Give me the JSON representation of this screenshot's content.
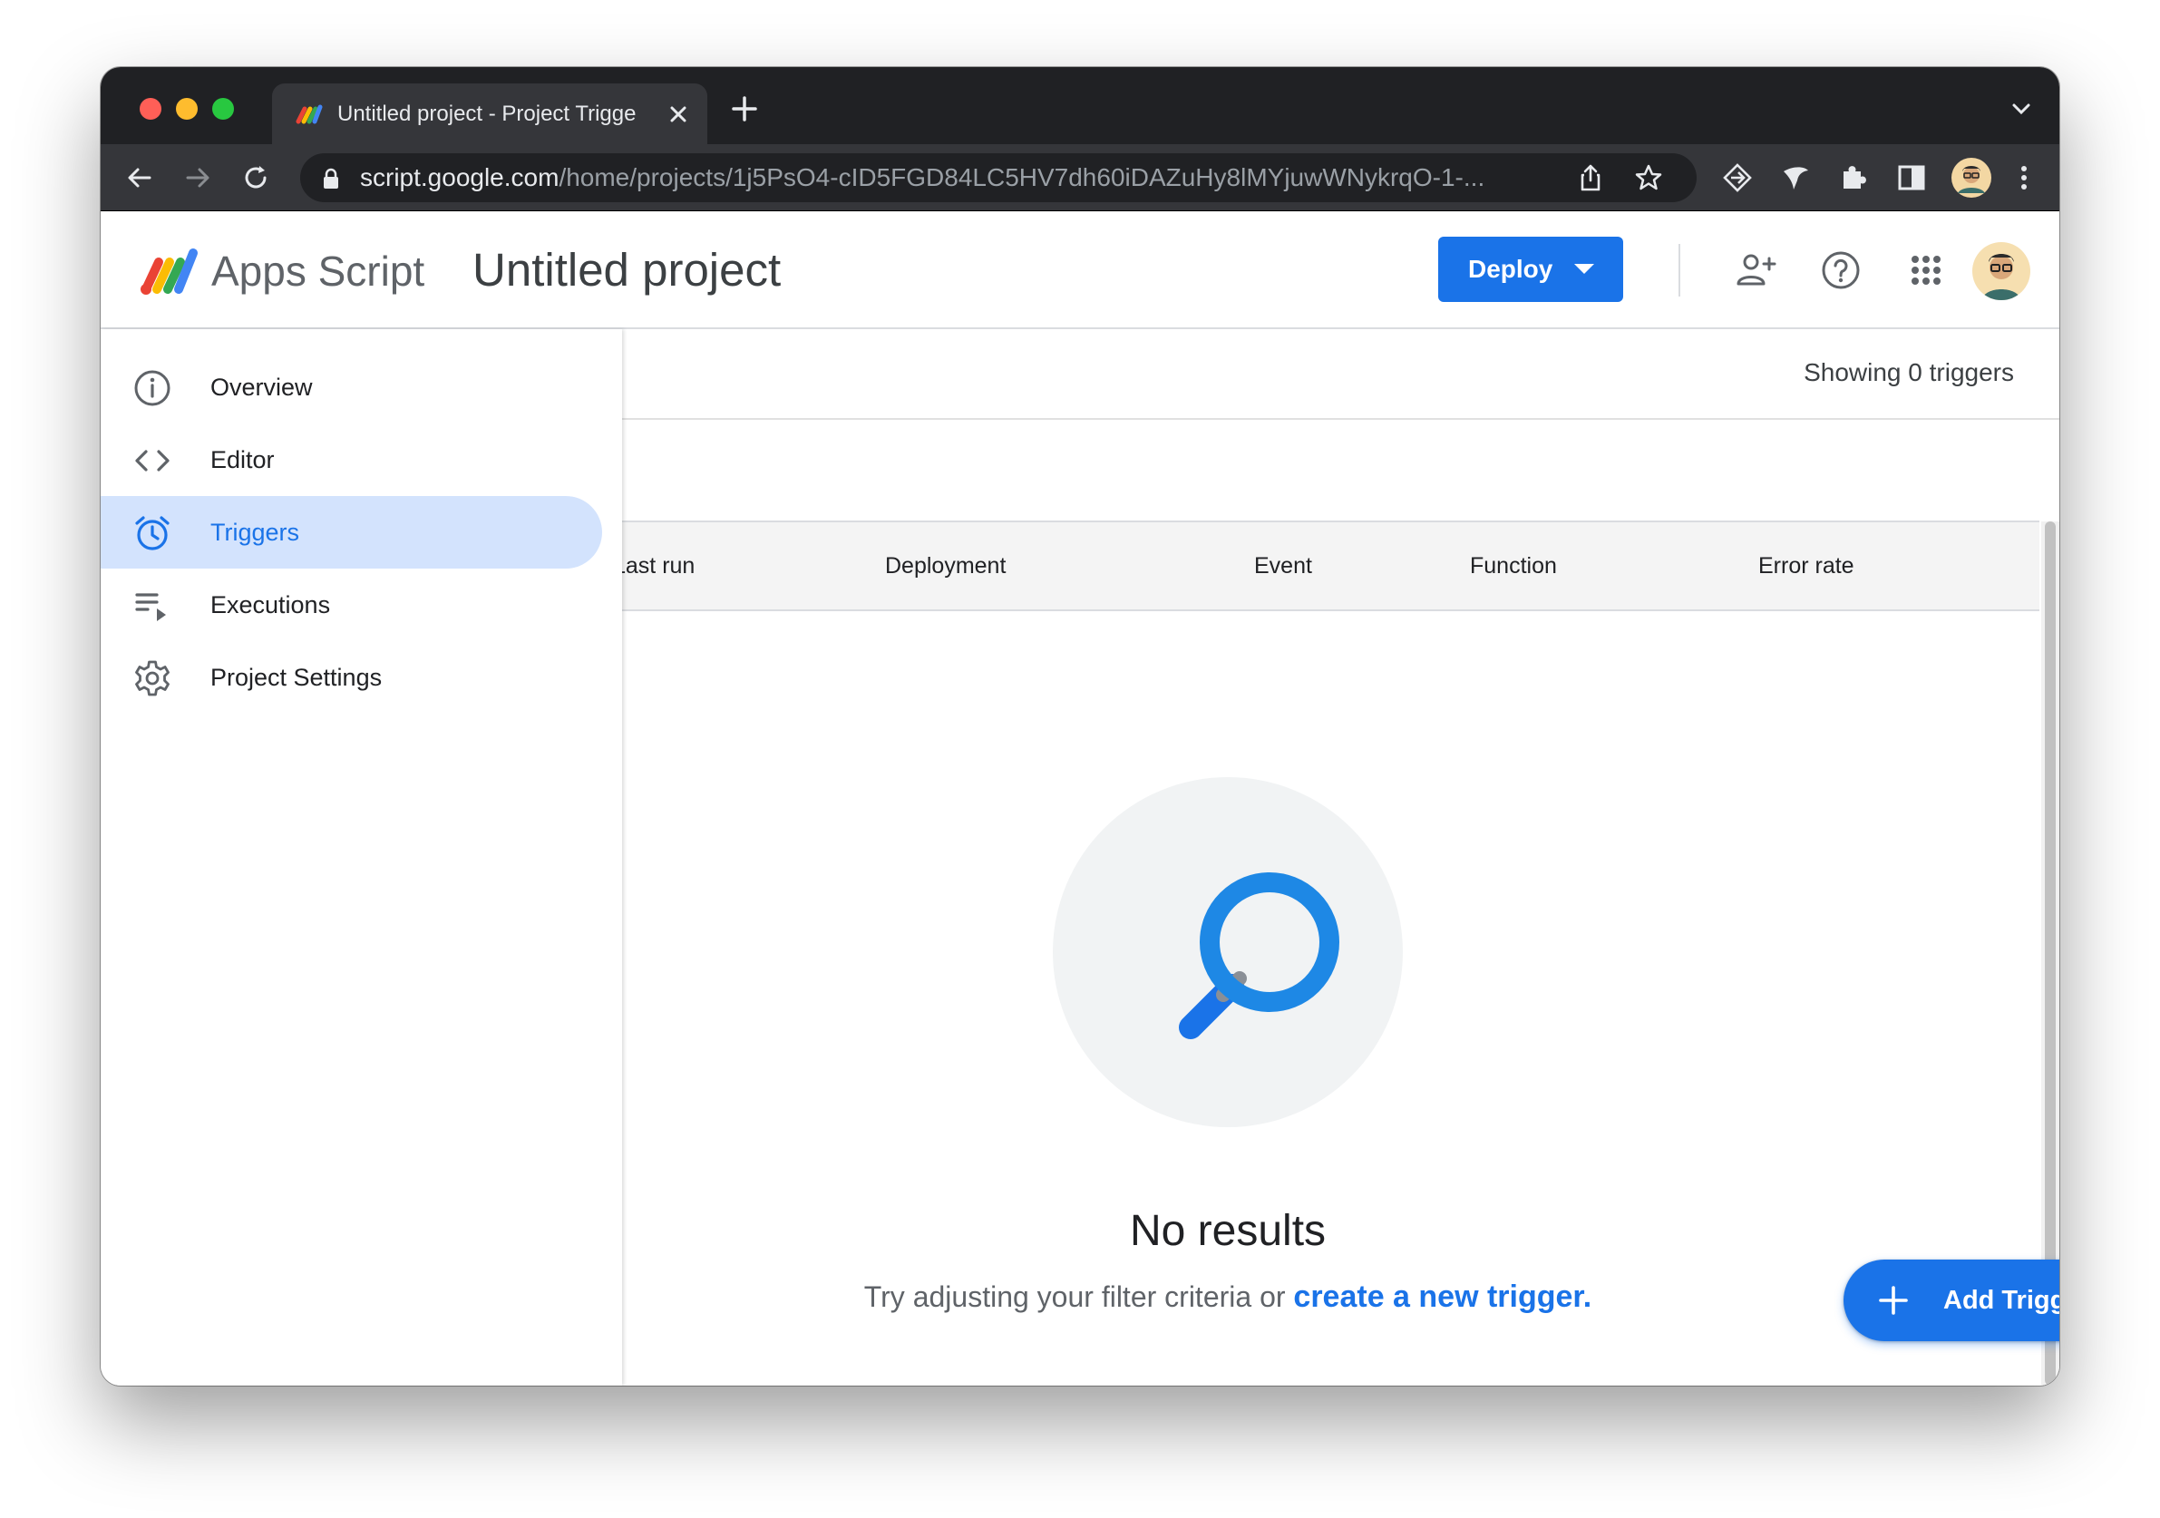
{
  "browser": {
    "tab_title": "Untitled project - Project Trigge",
    "url_host": "script.google.com",
    "url_path": "/home/projects/1j5PsO4-cID5FGD84LC5HV7dh60iDAZuHy8lMYjuwWNykrqO-1-..."
  },
  "header": {
    "brand": "Apps Script",
    "project_title": "Untitled project",
    "deploy_label": "Deploy"
  },
  "sidebar": {
    "items": [
      {
        "label": "Overview",
        "icon": "info-icon"
      },
      {
        "label": "Editor",
        "icon": "code-icon"
      },
      {
        "label": "Triggers",
        "icon": "alarm-clock-icon",
        "active": true
      },
      {
        "label": "Executions",
        "icon": "list-play-icon"
      },
      {
        "label": "Project Settings",
        "icon": "gear-icon"
      }
    ]
  },
  "main": {
    "showing": "Showing 0 triggers",
    "columns": [
      "Last run",
      "Deployment",
      "Event",
      "Function",
      "Error rate"
    ],
    "empty_title": "No results",
    "empty_hint": "Try adjusting your filter criteria or ",
    "empty_link": "create a new trigger.",
    "add_trigger": "Add Trigger"
  },
  "colors": {
    "accent": "#1a73e8",
    "active_nav_bg": "#d3e3fd",
    "chrome_dark": "#202124",
    "chrome_toolbar": "#35363a"
  }
}
